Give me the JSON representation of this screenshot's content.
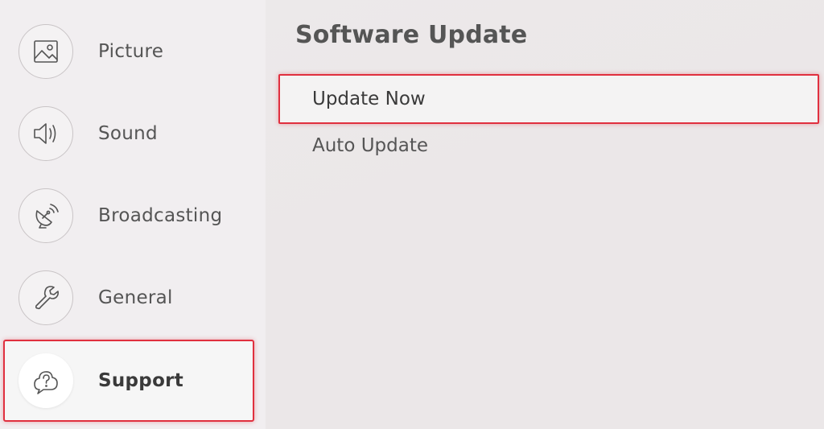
{
  "sidebar": {
    "items": [
      {
        "label": "Picture",
        "icon": "picture-icon",
        "selected": false
      },
      {
        "label": "Sound",
        "icon": "speaker-icon",
        "selected": false
      },
      {
        "label": "Broadcasting",
        "icon": "satellite-dish-icon",
        "selected": false
      },
      {
        "label": "General",
        "icon": "wrench-icon",
        "selected": false
      },
      {
        "label": "Support",
        "icon": "help-cloud-icon",
        "selected": true
      }
    ]
  },
  "main": {
    "title": "Software Update",
    "options": [
      {
        "label": "Update Now",
        "selected": true
      },
      {
        "label": "Auto Update",
        "selected": false
      }
    ]
  },
  "colors": {
    "focus_border": "#e0303f",
    "sidebar_bg": "#f1eef0",
    "content_bg": "#ece9ea",
    "text": "#555555"
  }
}
